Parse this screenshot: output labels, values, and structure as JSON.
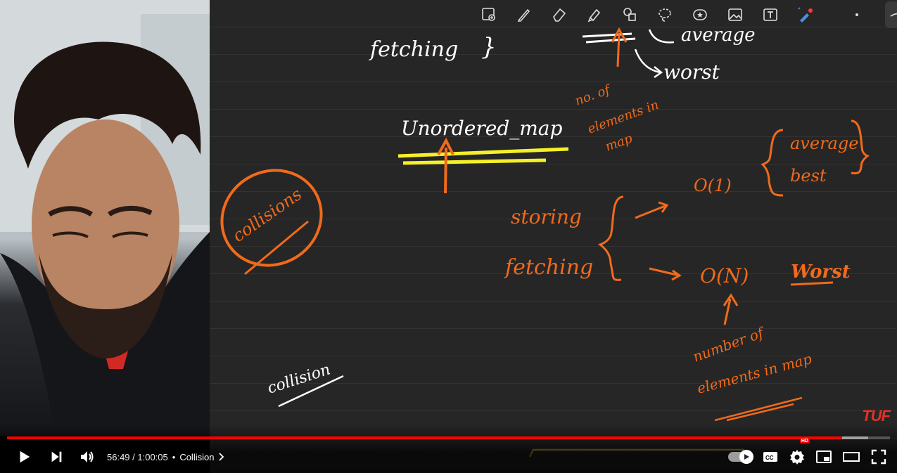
{
  "toolbar": {
    "tools": [
      {
        "name": "image-zoom-icon"
      },
      {
        "name": "pen-icon"
      },
      {
        "name": "eraser-icon"
      },
      {
        "name": "highlighter-icon"
      },
      {
        "name": "shapes-icon"
      },
      {
        "name": "lasso-icon"
      },
      {
        "name": "sticker-icon"
      },
      {
        "name": "image-icon"
      },
      {
        "name": "text-box-icon"
      },
      {
        "name": "laser-pointer-icon"
      }
    ]
  },
  "board": {
    "texts": {
      "fetching_top": "fetching",
      "brace_top": "}",
      "worst_top": "worst",
      "average_top": "average",
      "no_of_elements_1": "no. of",
      "no_of_elements_2": "elements in",
      "no_of_elements_3": "map",
      "unordered_map": "Unordered_map",
      "collisions": "collisions",
      "storing": "storing",
      "fetching": "fetching",
      "o1": "O(1)",
      "average": "average",
      "best": "best",
      "oN": "O(N)",
      "worst": "Worst",
      "number_of": "number of",
      "elements_in_map": "elements in map",
      "collision": "collision"
    },
    "colors": {
      "orange": "#f26a1b",
      "yellow": "#f5f02a",
      "white": "#ffffff"
    }
  },
  "watermark": "TUF",
  "player": {
    "current_time": "56:49",
    "duration": "1:00:05",
    "time_display": "56:49 / 1:00:05",
    "chapter_separator": "•",
    "chapter": "Collision",
    "progress_fraction": 0.9456,
    "quality_badge": "HD",
    "buttons": {
      "play": "play-icon",
      "next": "next-icon",
      "volume": "volume-icon",
      "autoplay": "autoplay-toggle",
      "captions": "captions-icon",
      "settings": "settings-icon",
      "miniplayer": "miniplayer-icon",
      "theater": "theater-icon",
      "fullscreen": "fullscreen-icon"
    }
  }
}
